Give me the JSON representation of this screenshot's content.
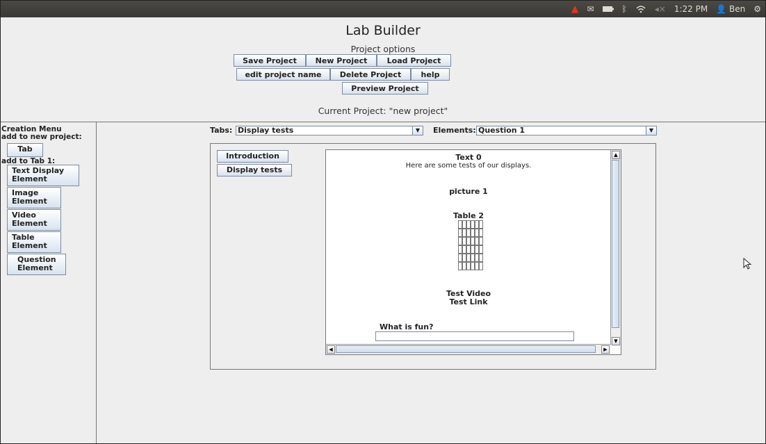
{
  "system_bar": {
    "time": "1:22 PM",
    "user": "Ben",
    "icons": [
      "alert-icon",
      "mail-icon",
      "battery-icon",
      "bluetooth-icon",
      "wifi-icon",
      "volume-icon",
      "user-icon",
      "gear-icon"
    ]
  },
  "header": {
    "title": "Lab Builder",
    "subtitle": "Project options",
    "buttons": {
      "save": "Save Project",
      "new": "New Project",
      "load": "Load Project",
      "edit_name": "edit project name",
      "delete": "Delete Project",
      "help": "help",
      "preview": "Preview Project"
    },
    "current_project": "Current Project: \"new project\""
  },
  "creation_menu": {
    "title_line1": "Creation Menu",
    "title_line2": "add to new project:",
    "tab_button": "Tab",
    "add_to_tab": "add to Tab 1:",
    "text_display_line1": "Text Display",
    "text_display_line2": "Element",
    "image_line1": "Image",
    "image_line2": "Element",
    "video_line1": "Video",
    "video_line2": "Element",
    "table_line1": "Table",
    "table_line2": "Element",
    "question_line1": "Question",
    "question_line2": "Element"
  },
  "selectors": {
    "tabs_label": "Tabs:",
    "tabs_value": "Display tests",
    "elements_label": "Elements:",
    "elements_value": "Question 1"
  },
  "preview": {
    "tab_buttons": [
      "Introduction",
      "Display tests"
    ],
    "text_title": "Text 0",
    "text_body": "Here are some tests of our displays.",
    "picture": "picture 1",
    "table": "Table 2",
    "table_rows": 6,
    "table_cols": 6,
    "video": "Test Video",
    "link": "Test Link",
    "question": "What is fun?"
  }
}
